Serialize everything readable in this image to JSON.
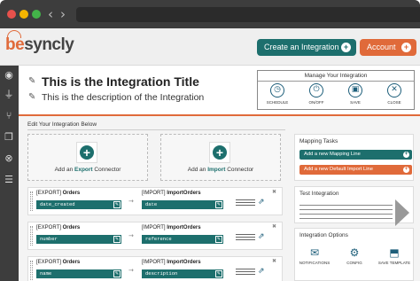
{
  "header": {
    "logo_be": "be",
    "logo_syncly": "syncly",
    "create_label": "Create an Integration",
    "create_icon": "+",
    "account_label": "Account",
    "account_icon": "+"
  },
  "title_area": {
    "title": "This is the Integration Title",
    "description": "This is the description of the Integration"
  },
  "manage": {
    "title": "Manage Your Integration",
    "actions": [
      {
        "label": "SCHEDULE",
        "icon": "clock-icon",
        "glyph": "◷"
      },
      {
        "label": "ON/OFF",
        "icon": "power-icon",
        "glyph": "⏻"
      },
      {
        "label": "SAVE",
        "icon": "save-icon",
        "glyph": "▣"
      },
      {
        "label": "CLOSE",
        "icon": "close-icon",
        "glyph": "✕"
      }
    ]
  },
  "main": {
    "edit_label": "Edit Your Integration Below",
    "export_prefix": "Add an ",
    "export_bold": "Export",
    "export_suffix": " Connector",
    "import_prefix": "Add an ",
    "import_bold": "Import",
    "import_suffix": " Connector",
    "rows": [
      {
        "export_tag": "[EXPORT]",
        "export_name": "Orders",
        "export_field": "date_created",
        "import_tag": "[IMPORT]",
        "import_name": "ImportOrders",
        "import_field": "date"
      },
      {
        "export_tag": "[EXPORT]",
        "export_name": "Orders",
        "export_field": "number",
        "import_tag": "[IMPORT]",
        "import_name": "ImportOrders",
        "import_field": "reference"
      },
      {
        "export_tag": "[EXPORT]",
        "export_name": "Orders",
        "export_field": "name",
        "import_tag": "[IMPORT]",
        "import_name": "ImportOrders",
        "import_field": "description"
      }
    ]
  },
  "right_panel": {
    "mapping_title": "Mapping Tasks",
    "add_mapping": "Add a new Mapping Line",
    "add_default_import": "Add a new Default Import Line",
    "test_title": "Test Integration",
    "options_title": "Integration Options",
    "options": [
      {
        "label": "NOTIFICATIONS",
        "glyph": "✉"
      },
      {
        "label": "CONFIG",
        "glyph": "⚙"
      },
      {
        "label": "SAVE TEMPLATE",
        "glyph": "⬒"
      }
    ]
  },
  "colors": {
    "teal": "#1d6f6d",
    "orange": "#e06a3a",
    "dark": "#3d3d3d"
  }
}
